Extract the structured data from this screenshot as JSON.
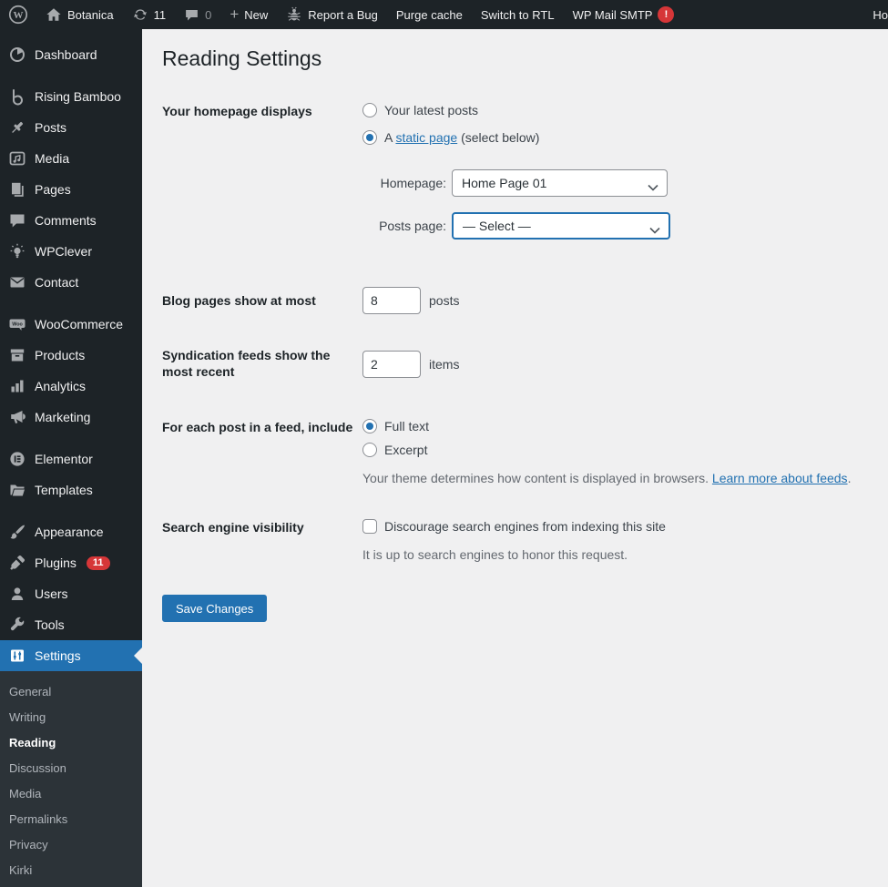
{
  "colors": {
    "accent": "#2271b1",
    "badge": "#d63638",
    "menu_bg": "#1d2327",
    "submenu_bg": "#2c3338",
    "content_bg": "#f0f0f1"
  },
  "admin_bar": {
    "site_name": "Botanica",
    "updates_count": "11",
    "comments_count": "0",
    "new_label": "New",
    "report_bug_label": "Report a Bug",
    "purge_cache_label": "Purge cache",
    "switch_rtl_label": "Switch to RTL",
    "wp_mail_smtp_label": "WP Mail SMTP",
    "wp_mail_smtp_badge": "!",
    "howdy_truncated": "Ho"
  },
  "sidebar": {
    "menu": [
      {
        "label": "Dashboard",
        "icon": "dashboard-icon"
      },
      {
        "label": "Rising Bamboo",
        "icon": "rising-bamboo-icon"
      },
      {
        "label": "Posts",
        "icon": "pin-icon"
      },
      {
        "label": "Media",
        "icon": "media-icon"
      },
      {
        "label": "Pages",
        "icon": "pages-icon"
      },
      {
        "label": "Comments",
        "icon": "comment-icon"
      },
      {
        "label": "WPClever",
        "icon": "lightbulb-icon"
      },
      {
        "label": "Contact",
        "icon": "envelope-icon"
      },
      {
        "label": "WooCommerce",
        "icon": "woocommerce-icon"
      },
      {
        "label": "Products",
        "icon": "box-icon"
      },
      {
        "label": "Analytics",
        "icon": "bar-chart-icon"
      },
      {
        "label": "Marketing",
        "icon": "megaphone-icon"
      },
      {
        "label": "Elementor",
        "icon": "elementor-icon"
      },
      {
        "label": "Templates",
        "icon": "folder-icon"
      },
      {
        "label": "Appearance",
        "icon": "brush-icon"
      },
      {
        "label": "Plugins",
        "icon": "plug-icon",
        "badge": "11"
      },
      {
        "label": "Users",
        "icon": "user-icon"
      },
      {
        "label": "Tools",
        "icon": "wrench-icon"
      },
      {
        "label": "Settings",
        "icon": "sliders-icon"
      }
    ],
    "settings_submenu": [
      {
        "label": "General"
      },
      {
        "label": "Writing"
      },
      {
        "label": "Reading"
      },
      {
        "label": "Discussion"
      },
      {
        "label": "Media"
      },
      {
        "label": "Permalinks"
      },
      {
        "label": "Privacy"
      },
      {
        "label": "Kirki"
      }
    ]
  },
  "main": {
    "title": "Reading Settings",
    "homepage_displays": {
      "label": "Your homepage displays",
      "option_latest": "Your latest posts",
      "option_static_prefix": "A ",
      "option_static_link": "static page",
      "option_static_suffix": " (select below)",
      "homepage_label": "Homepage:",
      "homepage_value": "Home Page 01",
      "posts_page_label": "Posts page:",
      "posts_page_value": "— Select —"
    },
    "blog_pages": {
      "label": "Blog pages show at most",
      "value": "8",
      "unit": "posts"
    },
    "syndication": {
      "label": "Syndication feeds show the most recent",
      "value": "2",
      "unit": "items"
    },
    "feed_include": {
      "label": "For each post in a feed, include",
      "option_full": "Full text",
      "option_excerpt": "Excerpt",
      "note_prefix": "Your theme determines how content is displayed in browsers. ",
      "note_link": "Learn more about feeds",
      "note_suffix": "."
    },
    "search_visibility": {
      "label": "Search engine visibility",
      "checkbox_label": "Discourage search engines from indexing this site",
      "note": "It is up to search engines to honor this request."
    },
    "save_label": "Save Changes"
  }
}
